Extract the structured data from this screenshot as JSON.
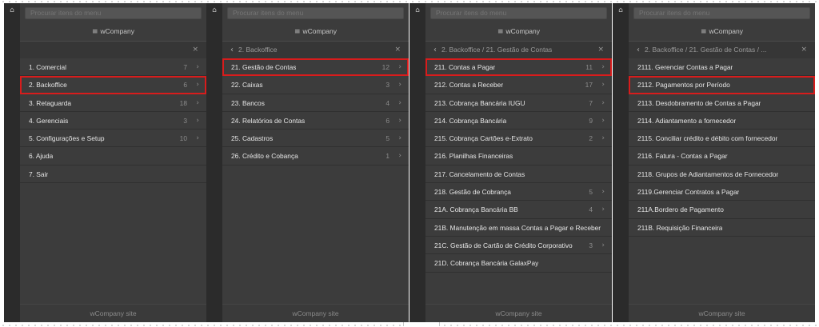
{
  "colors": {
    "highlight": "#d81c1c",
    "panel_bg": "#3c3c3c",
    "rail_bg": "#2b2b2b"
  },
  "panels": [
    {
      "search_placeholder": "Procurar itens do menu",
      "brand": "wCompany",
      "brand_icon": "menu-icon",
      "head": {
        "back": false,
        "label": ""
      },
      "items": [
        {
          "label": "1. Comercial",
          "count": "7",
          "sub": true
        },
        {
          "label": "2. Backoffice",
          "count": "6",
          "sub": true,
          "active": true
        },
        {
          "label": "3. Retaguarda",
          "count": "18",
          "sub": true
        },
        {
          "label": "4. Gerenciais",
          "count": "3",
          "sub": true
        },
        {
          "label": "5. Configurações e Setup",
          "count": "10",
          "sub": true
        },
        {
          "label": "6. Ajuda",
          "count": "",
          "sub": false
        },
        {
          "label": "7. Sair",
          "count": "",
          "sub": false
        }
      ],
      "footer": "wCompany site"
    },
    {
      "search_placeholder": "Procurar itens do menu",
      "brand": "wCompany",
      "brand_icon": "menu-icon",
      "head": {
        "back": true,
        "label": "2. Backoffice"
      },
      "items": [
        {
          "label": "21. Gestão de Contas",
          "count": "12",
          "sub": true,
          "active": true
        },
        {
          "label": "22. Caixas",
          "count": "3",
          "sub": true
        },
        {
          "label": "23. Bancos",
          "count": "4",
          "sub": true
        },
        {
          "label": "24. Relatórios de Contas",
          "count": "6",
          "sub": true
        },
        {
          "label": "25. Cadastros",
          "count": "5",
          "sub": true
        },
        {
          "label": "26. Crédito e Cobança",
          "count": "1",
          "sub": true
        }
      ],
      "footer": "wCompany site"
    },
    {
      "search_placeholder": "Procurar itens do menu",
      "brand": "wCompany",
      "brand_icon": "menu-icon",
      "head": {
        "back": true,
        "label": "2. Backoffice / 21. Gestão de Contas"
      },
      "items": [
        {
          "label": "211. Contas a Pagar",
          "count": "11",
          "sub": true,
          "active": true
        },
        {
          "label": "212. Contas a Receber",
          "count": "17",
          "sub": true
        },
        {
          "label": "213. Cobrança Bancária IUGU",
          "count": "7",
          "sub": true
        },
        {
          "label": "214. Cobrança Bancária",
          "count": "9",
          "sub": true
        },
        {
          "label": "215. Cobrança Cartões e-Extrato",
          "count": "2",
          "sub": true
        },
        {
          "label": "216. Planilhas Financeiras",
          "count": "",
          "sub": false
        },
        {
          "label": "217. Cancelamento de Contas",
          "count": "",
          "sub": false
        },
        {
          "label": "218. Gestão de Cobrança",
          "count": "5",
          "sub": true
        },
        {
          "label": "21A. Cobrança Bancária BB",
          "count": "4",
          "sub": true
        },
        {
          "label": "21B. Manutenção em massa Contas a Pagar e Receber",
          "count": "",
          "sub": false
        },
        {
          "label": "21C. Gestão de Cartão de Crédito Corporativo",
          "count": "3",
          "sub": true
        },
        {
          "label": "21D. Cobrança Bancária GalaxPay",
          "count": "",
          "sub": false
        }
      ],
      "footer": "wCompany site"
    },
    {
      "search_placeholder": "Procurar itens do menu",
      "brand": "wCompany",
      "brand_icon": "menu-icon",
      "head": {
        "back": true,
        "label": "2. Backoffice / 21. Gestão de Contas / ..."
      },
      "items": [
        {
          "label": "2111. Gerenciar Contas a Pagar",
          "count": "",
          "sub": false
        },
        {
          "label": "2112. Pagamentos por Período",
          "count": "",
          "sub": false,
          "active": true
        },
        {
          "label": "2113. Desdobramento de Contas a Pagar",
          "count": "",
          "sub": false
        },
        {
          "label": "2114. Adiantamento a fornecedor",
          "count": "",
          "sub": false
        },
        {
          "label": "2115. Conciliar crédito e débito com fornecedor",
          "count": "",
          "sub": false
        },
        {
          "label": "2116. Fatura - Contas a Pagar",
          "count": "",
          "sub": false
        },
        {
          "label": "2118. Grupos de Adiantamentos de Fornecedor",
          "count": "",
          "sub": false
        },
        {
          "label": "2119.Gerenciar Contratos a Pagar",
          "count": "",
          "sub": false
        },
        {
          "label": "211A.Bordero de Pagamento",
          "count": "",
          "sub": false
        },
        {
          "label": "211B. Requisição Financeira",
          "count": "",
          "sub": false
        }
      ],
      "footer": "wCompany site"
    }
  ]
}
